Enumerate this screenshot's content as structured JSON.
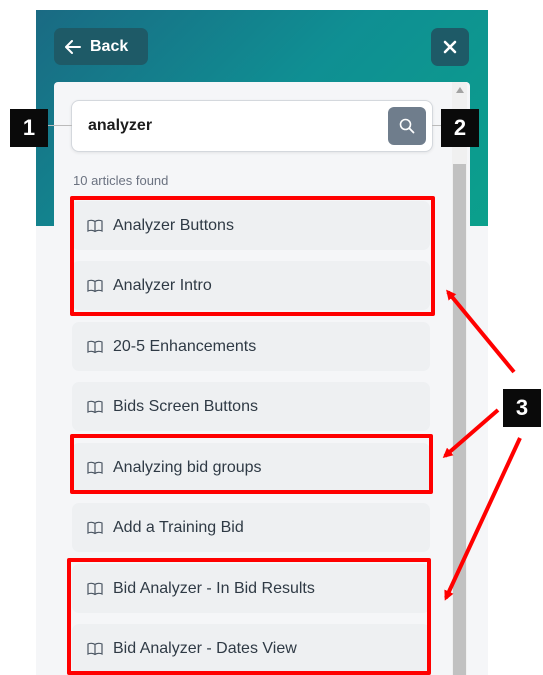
{
  "header": {
    "back_label": "Back"
  },
  "search": {
    "value": "analyzer"
  },
  "results": {
    "count_text": "10 articles found",
    "articles": [
      "Analyzer Buttons",
      "Analyzer Intro",
      "20-5 Enhancements",
      "Bids Screen Buttons",
      "Analyzing bid groups",
      "Add a Training Bid",
      "Bid Analyzer - In Bid Results",
      "Bid Analyzer - Dates View"
    ]
  },
  "callouts": [
    "1",
    "2",
    "3"
  ],
  "colors": {
    "header_accent": "#0f8f93",
    "button_dark": "#1e5a67",
    "highlight": "#ff0000",
    "search_button": "#6f7d8c"
  }
}
